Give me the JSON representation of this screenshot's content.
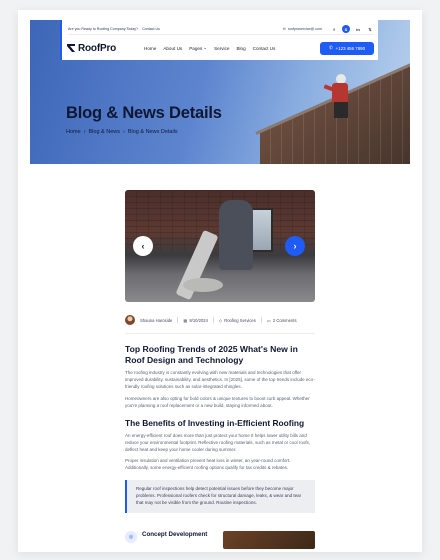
{
  "topbar": {
    "tagline": "Are you Ready to Roofing Company Today?",
    "contact_link": "Contact Us",
    "email": "roofproservice@.com",
    "social": [
      {
        "icon": "facebook-icon",
        "glyph": "f"
      },
      {
        "icon": "skype-icon",
        "glyph": "S"
      },
      {
        "icon": "linkedin-icon",
        "glyph": "in"
      },
      {
        "icon": "x-icon",
        "glyph": "𝕏"
      }
    ]
  },
  "nav": {
    "logo": "RoofPro",
    "items": [
      "Home",
      "About Us",
      "Pages",
      "Service",
      "Blog",
      "Contact Us"
    ],
    "phone": "+123 456 7890"
  },
  "hero": {
    "title": "Blog & News Details",
    "breadcrumb": [
      "Home",
      "Blog & News",
      "Blog & News Details"
    ]
  },
  "post": {
    "author": "Shauna Haroside",
    "date": "8/10/2024",
    "category": "Roofing Services",
    "comments": "2 Comments",
    "title": "Top Roofing Trends of 2025 What's New in Roof Design and Technology",
    "para1": "The roofing industry is constantly evolving with new materials and technologies that offer improved durability, sustainability, and aesthetics. In [2025], some of the top trends include eco-friendly roofing solutions such as solar-integrated shingles.",
    "para2": "Homeowners are also opting for bold colors & unique textures to boost curb appeal. Whether you're planning a roof replacement or a new build, staying informed about.",
    "subtitle": "The Benefits of Investing in-Efficient Roofing",
    "para3": "An energy-efficient roof does more than just protect your home It helps lower utility bills and reduce your environmental footprint. Reflective roofing materials, such as metal or cool roofs, deflect heat and keep your home cooler during summer.",
    "para4": "Proper insulation and ventilation prevent heat loss in winter, an year-round comfort. Additionally, some energy-efficient roofing options qualify for tax credits & rebates.",
    "quote": "Regular roof inspections help detect potential issues before they become major problems. Professional roofers check for structural damage, leaks, & wear and tear that may not be visible from the ground. Routine inspections.",
    "concept_title": "Concept Development"
  },
  "colors": {
    "accent": "#1f5cf5",
    "heading": "#0f1733",
    "body_text": "#5b6075"
  }
}
